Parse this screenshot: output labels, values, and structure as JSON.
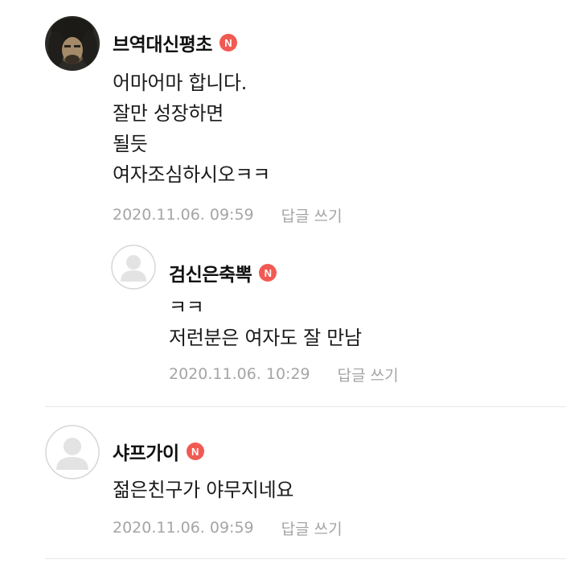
{
  "comments": [
    {
      "author": "브역대신평초",
      "badge": "N",
      "lines": [
        "어마어마 합니다.",
        "잘만 성장하면",
        "될듯",
        "여자조심하시오ㅋㅋ"
      ],
      "timestamp": "2020.11.06. 09:59",
      "reply_label": "답글 쓰기",
      "avatar": "profile-photo",
      "replies": [
        {
          "author": "검신은축뽁",
          "badge": "N",
          "lines": [
            "ㅋㅋ",
            "저런분은 여자도 잘 만남"
          ],
          "timestamp": "2020.11.06. 10:29",
          "reply_label": "답글 쓰기",
          "avatar": "default-user-icon"
        }
      ]
    },
    {
      "author": "샤프가이",
      "badge": "N",
      "lines": [
        "젊은친구가 야무지네요"
      ],
      "timestamp": "2020.11.06. 09:59",
      "reply_label": "답글 쓰기",
      "avatar": "default-user-icon",
      "replies": []
    }
  ],
  "colors": {
    "badge": "#f15a52",
    "meta_text": "#a5a5a5",
    "divider": "#e8e8e8",
    "body_text": "#1a1a1a"
  }
}
